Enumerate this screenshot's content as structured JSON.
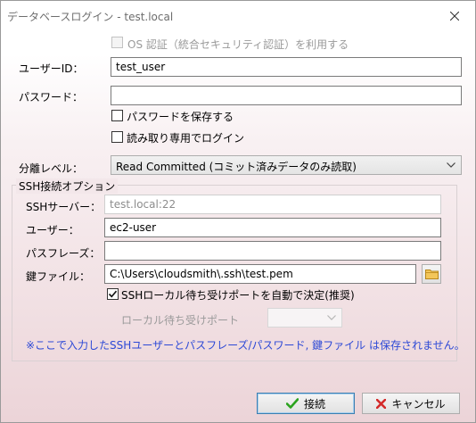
{
  "window": {
    "title": "データベースログイン - test.local"
  },
  "os_auth": {
    "label": "OS 認証（統合セキュリティ認証）を利用する",
    "checked": false,
    "enabled": false
  },
  "user_id": {
    "label": "ユーザーID：",
    "value": "test_user"
  },
  "password": {
    "label": "パスワード：",
    "value": ""
  },
  "save_password": {
    "label": "パスワードを保存する",
    "checked": false
  },
  "read_only": {
    "label": "読み取り専用でログイン",
    "checked": false
  },
  "isolation": {
    "label": "分離レベル：",
    "value": "Read Committed (コミット済みデータのみ読取)"
  },
  "ssh": {
    "group_title": "SSH接続オプション",
    "server_label": "SSHサーバー：",
    "server_value": "test.local:22",
    "user_label": "ユーザー：",
    "user_value": "ec2-user",
    "passphrase_label": "パスフレーズ：",
    "passphrase_value": "",
    "keyfile_label": "鍵ファイル：",
    "keyfile_value": "C:\\Users\\cloudsmith\\.ssh\\test.pem",
    "auto_port_label": "SSHローカル待ち受けポートを自動で決定(推奨)",
    "auto_port_checked": true,
    "local_port_label": "ローカル待ち受けポート",
    "local_port_value": "",
    "note": "※ここで入力したSSHユーザーとパスフレーズ/パスワード, 鍵ファイル は保存されません。"
  },
  "buttons": {
    "connect": "接続",
    "cancel": "キャンセル"
  },
  "colors": {
    "note_text": "#2d49d6",
    "connect_check": "#2aa31e",
    "cancel_x": "#d42a2a",
    "folder": "#e8b33a"
  }
}
